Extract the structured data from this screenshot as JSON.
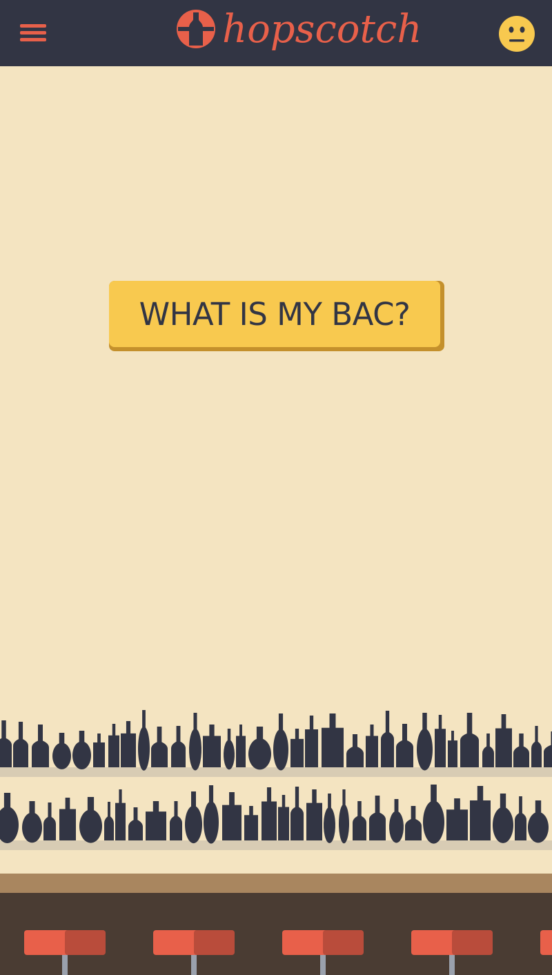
{
  "header": {
    "brand_name": "hopscotch",
    "menu_icon": "hamburger-menu-icon",
    "logo_icon": "bottle-in-circle-icon",
    "mood_icon": "neutral-face-emoji-icon",
    "background_color": "#323544",
    "accent_color": "#e8604a"
  },
  "main": {
    "cta_label": "WHAT IS MY BAC?",
    "cta_color": "#f8c94f",
    "background_color": "#f4e4c1"
  },
  "scene": {
    "description_icon": "bar-shelves-bottles-illustration",
    "bottle_color": "#323544",
    "bar_top_color": "#a9865f",
    "bar_front_color": "#4a3c33",
    "stool_color": "#e8604a",
    "stool_count": 5
  }
}
